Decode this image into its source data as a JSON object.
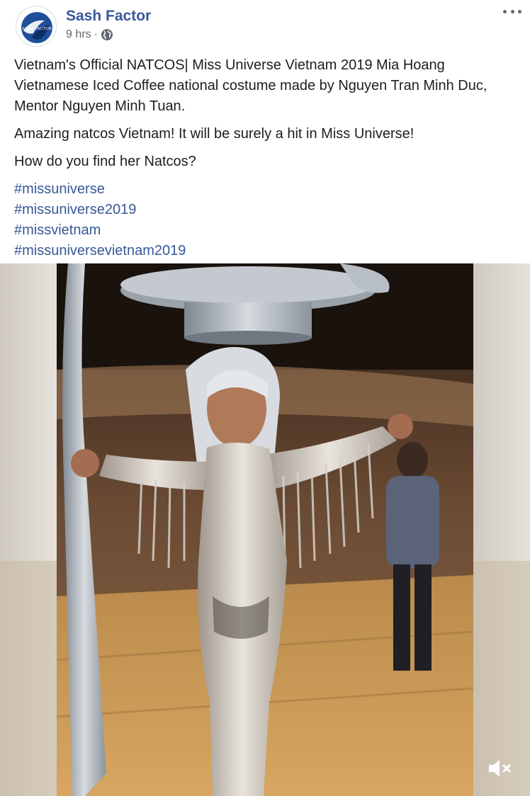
{
  "post": {
    "page_name": "Sash Factor",
    "timestamp": "9 hrs",
    "separator": "·",
    "privacy_icon": "globe-icon",
    "more_icon": "more-options-icon",
    "avatar_text": "SASH FACTOR",
    "body": [
      "Vietnam's Official NATCOS| Miss Universe Vietnam 2019 Mia Hoang Vietnamese Iced Coffee national costume made by Nguyen Tran Minh Duc, Mentor Nguyen Minh Tuan.",
      "Amazing natcos Vietnam! It will be surely a hit in Miss Universe!",
      "How do you find her Natcos?"
    ],
    "hashtags": [
      "#missuniverse",
      "#missuniverse2019",
      "#missvietnam",
      "#missuniversevietnam2019"
    ]
  },
  "video": {
    "mute_icon": "speaker-muted-icon"
  },
  "colors": {
    "link": "#385898",
    "text": "#1c1e21",
    "meta": "#616770"
  }
}
